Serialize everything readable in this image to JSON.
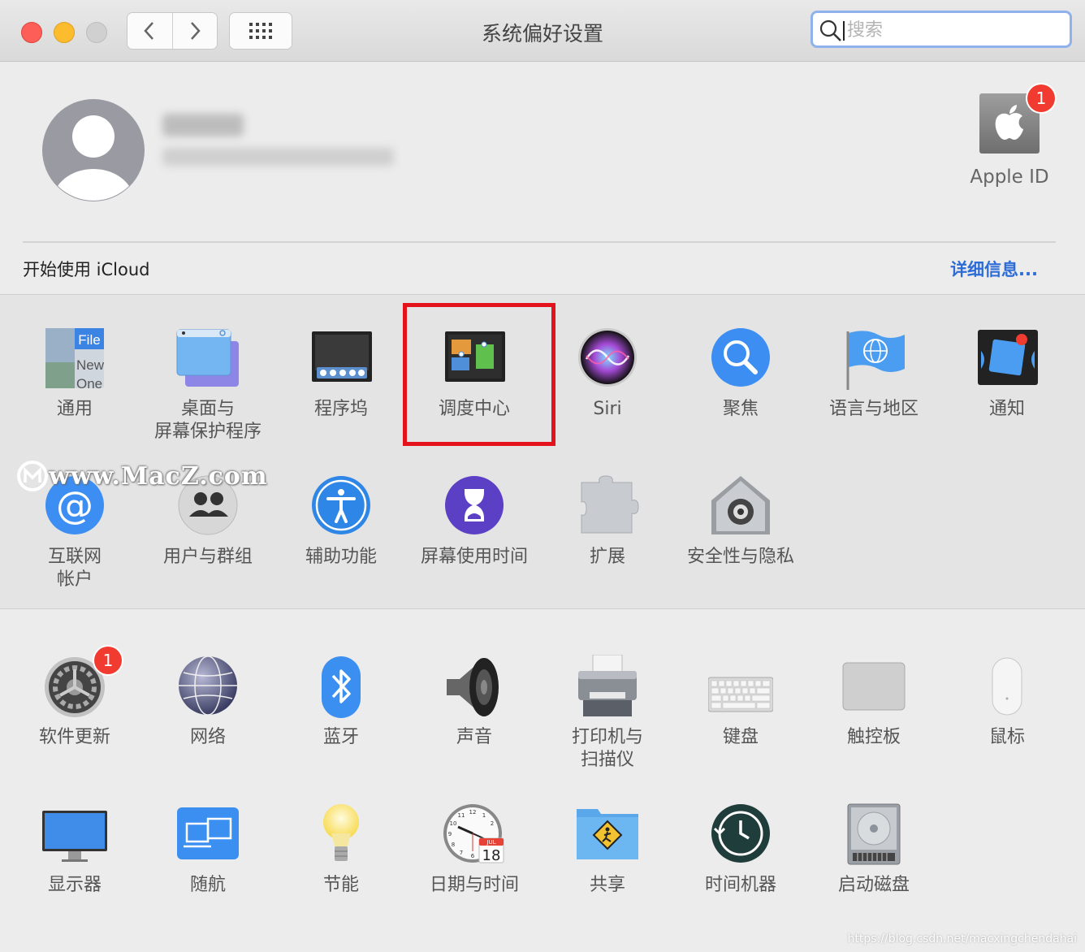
{
  "window": {
    "title": "系统偏好设置"
  },
  "search": {
    "placeholder": "搜索"
  },
  "account": {
    "apple_id_label": "Apple ID",
    "apple_id_badge": "1"
  },
  "icloud": {
    "prompt": "开始使用 iCloud",
    "details_link": "详细信息..."
  },
  "prefs_row1": [
    {
      "label": "通用",
      "icon": "general-icon"
    },
    {
      "label": "桌面与\n屏幕保护程序",
      "icon": "desktop-screensaver-icon"
    },
    {
      "label": "程序坞",
      "icon": "dock-icon"
    },
    {
      "label": "调度中心",
      "icon": "mission-control-icon",
      "highlighted": true
    },
    {
      "label": "Siri",
      "icon": "siri-icon"
    },
    {
      "label": "聚焦",
      "icon": "spotlight-icon"
    },
    {
      "label": "语言与地区",
      "icon": "language-region-icon"
    },
    {
      "label": "通知",
      "icon": "notifications-icon"
    }
  ],
  "prefs_row2": [
    {
      "label": "互联网\n帐户",
      "icon": "internet-accounts-icon"
    },
    {
      "label": "用户与群组",
      "icon": "users-groups-icon"
    },
    {
      "label": "辅助功能",
      "icon": "accessibility-icon"
    },
    {
      "label": "屏幕使用时间",
      "icon": "screen-time-icon"
    },
    {
      "label": "扩展",
      "icon": "extensions-icon"
    },
    {
      "label": "安全性与隐私",
      "icon": "security-privacy-icon"
    }
  ],
  "prefs_row3": [
    {
      "label": "软件更新",
      "icon": "software-update-icon",
      "badge": "1"
    },
    {
      "label": "网络",
      "icon": "network-icon"
    },
    {
      "label": "蓝牙",
      "icon": "bluetooth-icon"
    },
    {
      "label": "声音",
      "icon": "sound-icon"
    },
    {
      "label": "打印机与\n扫描仪",
      "icon": "printers-scanners-icon"
    },
    {
      "label": "键盘",
      "icon": "keyboard-icon"
    },
    {
      "label": "触控板",
      "icon": "trackpad-icon"
    },
    {
      "label": "鼠标",
      "icon": "mouse-icon"
    }
  ],
  "prefs_row4": [
    {
      "label": "显示器",
      "icon": "displays-icon"
    },
    {
      "label": "随航",
      "icon": "sidecar-icon"
    },
    {
      "label": "节能",
      "icon": "energy-saver-icon"
    },
    {
      "label": "日期与时间",
      "icon": "date-time-icon"
    },
    {
      "label": "共享",
      "icon": "sharing-icon"
    },
    {
      "label": "时间机器",
      "icon": "time-machine-icon"
    },
    {
      "label": "启动磁盘",
      "icon": "startup-disk-icon"
    }
  ],
  "icon_text": {
    "general_file": "File",
    "general_new": "New",
    "general_one": "One",
    "calendar_month": "JUL",
    "calendar_day": "18",
    "clock_12": "12",
    "clock_1": "1",
    "clock_2": "2",
    "clock_10": "10",
    "clock_11": "11",
    "clock_9": "9",
    "clock_8": "8",
    "clock_7": "7",
    "clock_6": "6"
  },
  "watermark": {
    "text": "www.MacZ.com",
    "credit": "https://blog.csdn.net/macxingchendahai"
  },
  "colors": {
    "accent_link": "#2d6cd6",
    "badge": "#f23b30",
    "highlight_box": "#e3121b"
  }
}
